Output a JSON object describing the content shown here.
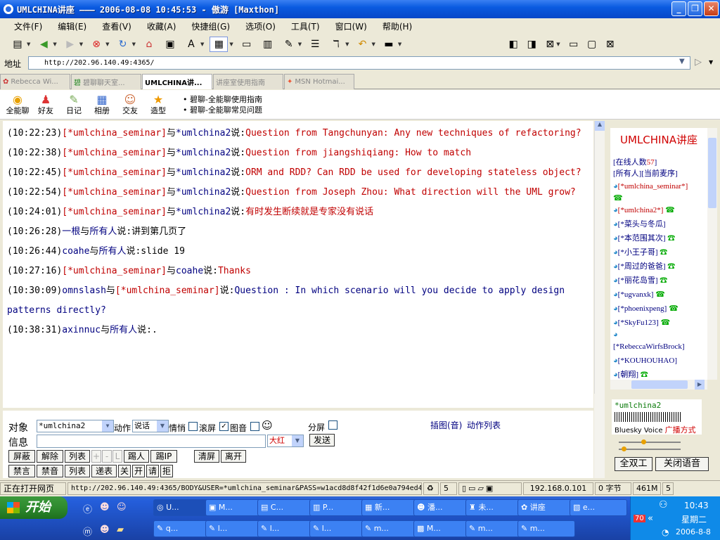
{
  "window": {
    "title": "UMLCHINA讲座 ——— 2006-08-08 10:45:53 - 傲游 [Maxthon]"
  },
  "menu": [
    "文件(F)",
    "编辑(E)",
    "查看(V)",
    "收藏(A)",
    "快捷组(G)",
    "选项(O)",
    "工具(T)",
    "窗口(W)",
    "帮助(H)"
  ],
  "address": {
    "label": "地址",
    "url": "http://202.96.140.49:4365/"
  },
  "tabs": [
    "Rebecca Wi...",
    "碧聊聊天室...",
    "UMLCHINA讲...",
    "讲座室使用指南",
    "MSN Hotmai..."
  ],
  "app_tools": [
    "全能聊",
    "好友",
    "日记",
    "相册",
    "交友",
    "造型"
  ],
  "app_links": [
    "碧聊-全能聊使用指南",
    "碧聊-全能聊常见问题"
  ],
  "messages": [
    {
      "time": "(10:22:23)",
      "speaker": "[*umlchina_seminar]",
      "yu": "与",
      "to": "*umlchina2",
      "shuo": "说:",
      "text": "Question from Tangchunyan: Any new techniques of refactoring?"
    },
    {
      "time": "(10:22:38)",
      "speaker": "[*umlchina_seminar]",
      "yu": "与",
      "to": "*umlchina2",
      "shuo": "说:",
      "text": "Question from jiangshiqiang: How to match"
    },
    {
      "time": "(10:22:45)",
      "speaker": "[*umlchina_seminar]",
      "yu": "与",
      "to": "*umlchina2",
      "shuo": "说:",
      "text": "ORM and RDD? Can RDD be used for developing stateless object?"
    },
    {
      "time": "(10:22:54)",
      "speaker": "[*umlchina_seminar]",
      "yu": "与",
      "to": "*umlchina2",
      "shuo": "说:",
      "text": "Question from Joseph Zhou: What direction will the UML grow?"
    },
    {
      "time": "(10:24:01)",
      "speaker": "[*umlchina_seminar]",
      "yu": "与",
      "to": "*umlchina2",
      "shuo": "说:",
      "text": "有时发生断续就是专家没有说话"
    },
    {
      "time": "(10:26:28)",
      "speaker": "一根",
      "yu": "与",
      "to": "所有人",
      "shuo": "说:",
      "text": "讲到第几页了"
    },
    {
      "time": "(10:26:44)",
      "speaker": "coahe",
      "yu": "与",
      "to": "所有人",
      "shuo": "说:",
      "text": "slide 19"
    },
    {
      "time": "(10:27:16)",
      "speaker": "[*umlchina_seminar]",
      "yu": "与",
      "to": "coahe",
      "shuo": "说:",
      "text": "Thanks"
    },
    {
      "time": "(10:30:09)",
      "speaker": "omnslash",
      "yu": "与",
      "to": "[*umlchina_seminar]",
      "shuo": "说:",
      "text": "Question : In which scenario will you decide to apply design patterns directly?"
    },
    {
      "time": "(10:38:31)",
      "speaker": "axinnuc",
      "yu": "与",
      "to": "所有人",
      "shuo": "说:",
      "text": "."
    }
  ],
  "input_panel": {
    "target_label": "对象",
    "target_value": "*umlchina2",
    "action_label": "动作",
    "action_value": "说话",
    "mood_label": "情悄",
    "scroll_label": "滚屏",
    "image_label": "图音",
    "split_label": "分屏",
    "insert_label": "插图(音)",
    "action_list_label": "动作列表",
    "message_label": "信息",
    "font_value": "大红",
    "send_label": "发送",
    "buttons_row1": [
      "屏蔽",
      "解除",
      "列表",
      "+",
      "-",
      "L",
      "踢人",
      "踢IP",
      "清屏",
      "离开"
    ],
    "buttons_row2": [
      "禁言",
      "禁音",
      "列表",
      "递表",
      "关",
      "开",
      "请",
      "拒"
    ]
  },
  "room": {
    "title": "UMLCHINA讲座",
    "online_label": "[在线人数",
    "online_count": "57",
    "online_suffix": "]",
    "filter_all": "[所有人]",
    "filter_sort": "[当前麦序]",
    "users": [
      "[*umlchina_seminar*]",
      "[*umlchina2*]",
      "[*菜头与冬瓜]",
      "[*本范围其次]",
      "[*小王子哥]",
      "[*周过的爸爸]",
      "[*丽花岛雪]",
      "[*ugvanxk]",
      "[*phoenixpeng]",
      "[*SkyFu123]",
      "[*RebeccaWirfsBrock]",
      "[*KOUHOUHAO]",
      "[朝翔]"
    ]
  },
  "voice": {
    "user": "*umlchina2",
    "brand": "Bluesky Voice",
    "mode": "广播方式",
    "duplex_button": "全双工",
    "close_button": "关闭语音"
  },
  "status": {
    "text": "正在打开网页",
    "url": "http://202.96.140.49:4365/BODY&USER=*umlchina_seminar&PASS=w1acd8d8f42f1d6e0a794ed4",
    "count": "5",
    "ip": "192.168.0.101",
    "bytes": "0 字节",
    "mem": "461M",
    "num": "5"
  },
  "taskbar": {
    "start": "开始",
    "row1": [
      "U...",
      "M...",
      "C...",
      "P...",
      "新...",
      "潘...",
      "未...",
      "讲座",
      "e..."
    ],
    "row2": [
      "q...",
      "l...",
      "l...",
      "l...",
      "m...",
      "M...",
      "m...",
      "m..."
    ],
    "clock": "10:43",
    "weekday": "星期二",
    "date": "2006-8-8"
  },
  "colors": {
    "titlebar": "#0a5ae0",
    "speaker": "#c00000",
    "name_blue": "#000080",
    "room_title": "#d00000"
  }
}
